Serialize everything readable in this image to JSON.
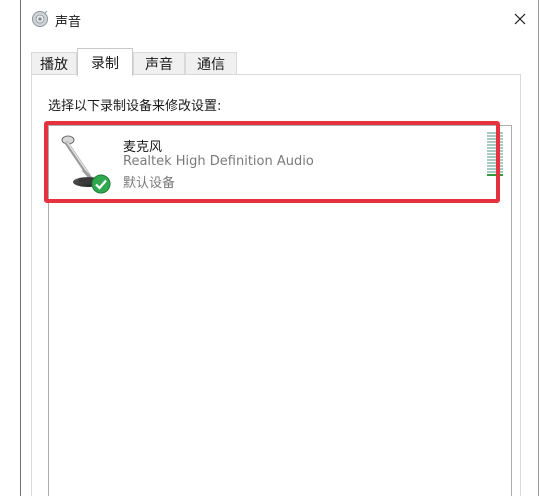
{
  "window": {
    "title": "声音"
  },
  "tabs": [
    {
      "label": "播放",
      "active": false
    },
    {
      "label": "录制",
      "active": true
    },
    {
      "label": "声音",
      "active": false
    },
    {
      "label": "通信",
      "active": false
    }
  ],
  "recording": {
    "instruction": "选择以下录制设备来修改设置:",
    "devices": [
      {
        "name": "麦克风",
        "driver": "Realtek High Definition Audio",
        "status": "默认设备",
        "icon": "microphone-icon",
        "badge": "default-check-icon",
        "level": 0.05
      }
    ]
  },
  "colors": {
    "highlight": "#e5323e",
    "check_green": "#2fa84f",
    "meter_idle": "#a9c9c3",
    "meter_lit": "#2f9e3a"
  }
}
